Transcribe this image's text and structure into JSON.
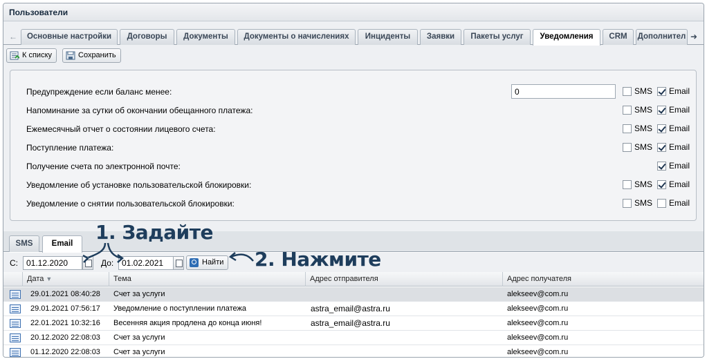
{
  "window": {
    "title": "Пользователи"
  },
  "tabs": [
    {
      "label": "Основные настройки"
    },
    {
      "label": "Договоры"
    },
    {
      "label": "Документы"
    },
    {
      "label": "Документы о начислениях"
    },
    {
      "label": "Инциденты"
    },
    {
      "label": "Заявки"
    },
    {
      "label": "Пакеты услуг"
    },
    {
      "label": "Уведомления"
    },
    {
      "label": "CRM"
    },
    {
      "label": "Дополнител"
    }
  ],
  "toolbar": {
    "back_label": "К списку",
    "save_label": "Сохранить"
  },
  "settings": {
    "sms_label": "SMS",
    "email_label": "Email",
    "balance_value": "0",
    "rows": [
      {
        "label": "Предупреждение если баланс менее:"
      },
      {
        "label": "Напоминание за сутки об окончании обещанного платежа:"
      },
      {
        "label": "Ежемесячный отчет о состоянии лицевого счета:"
      },
      {
        "label": "Поступление платежа:"
      },
      {
        "label": "Получение счета по электронной почте:"
      },
      {
        "label": "Уведомление об установке пользовательской блокировки:"
      },
      {
        "label": "Уведомление о снятии пользовательской блокировки:"
      }
    ],
    "sms_checked": [
      false,
      false,
      false,
      false,
      null,
      false,
      false
    ],
    "email_checked": [
      true,
      true,
      true,
      true,
      true,
      true,
      false
    ]
  },
  "subtabs": [
    {
      "label": "SMS"
    },
    {
      "label": "Email"
    }
  ],
  "filter": {
    "from_label": "С:",
    "from_value": "01.12.2020",
    "to_label": "До:",
    "to_value": "01.02.2021",
    "find_label": "Найти"
  },
  "grid": {
    "columns": [
      "Дата",
      "Тема",
      "Адрес отправителя",
      "Адрес получателя"
    ],
    "rows": [
      {
        "date": "29.01.2021 08:40:28",
        "subject": "Счет за услуги",
        "from": "",
        "to": "alekseev@com.ru"
      },
      {
        "date": "29.01.2021 07:56:17",
        "subject": "Уведомление о поступлении платежа",
        "from": "astra_email@astra.ru",
        "to": "alekseev@com.ru"
      },
      {
        "date": "22.01.2021 10:32:16",
        "subject": "Весенняя акция продлена до конца июня!",
        "from": "astra_email@astra.ru",
        "to": "alekseev@com.ru"
      },
      {
        "date": "20.12.2020 22:08:03",
        "subject": "Счет за услуги",
        "from": "",
        "to": "alekseev@com.ru"
      },
      {
        "date": "01.12.2020 22:08:03",
        "subject": "Счет за услуги",
        "from": "",
        "to": "alekseev@com.ru"
      }
    ]
  },
  "annotations": {
    "step1": "1. Задайте",
    "step2": "2. Нажмите"
  },
  "colors": {
    "annotation": "#1e3d5c",
    "accent": "#2e6db4"
  }
}
